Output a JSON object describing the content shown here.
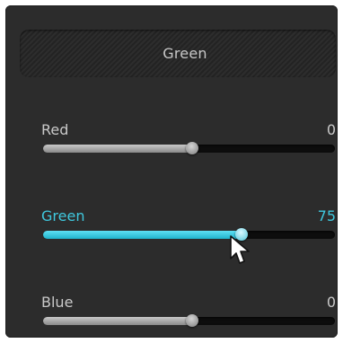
{
  "header": {
    "title": "Green"
  },
  "sliders": [
    {
      "label": "Red",
      "value": "0",
      "fill_percent": 51,
      "active": false
    },
    {
      "label": "Green",
      "value": "75",
      "fill_percent": 68,
      "active": true
    },
    {
      "label": "Blue",
      "value": "0",
      "fill_percent": 51,
      "active": false
    }
  ],
  "colors": {
    "panel_bg": "#2c2c2c",
    "accent": "#3fc8de",
    "text": "#c9c9c9"
  },
  "icons": {
    "cursor": "mouse-pointer-icon"
  }
}
